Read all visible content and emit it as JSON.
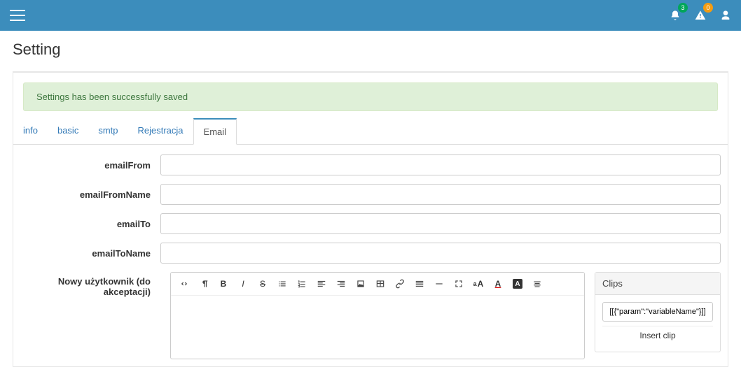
{
  "topbar": {
    "notif_badge": "3",
    "warn_badge": "0"
  },
  "page": {
    "title": "Setting",
    "alert": "Settings has been successfully saved"
  },
  "tabs": [
    "info",
    "basic",
    "smtp",
    "Rejestracja",
    "Email"
  ],
  "active_tab": "Email",
  "form": {
    "emailFrom_label": "emailFrom",
    "emailFrom_value": "",
    "emailFromName_label": "emailFromName",
    "emailFromName_value": "",
    "emailTo_label": "emailTo",
    "emailTo_value": "",
    "emailToName_label": "emailToName",
    "emailToName_value": "",
    "editor_label": "Nowy użytkownik (do akceptacji)"
  },
  "clips": {
    "title": "Clips",
    "placeholder": "[[{\"param\":\"variableName\"}]]",
    "insert_label": "Insert clip"
  }
}
